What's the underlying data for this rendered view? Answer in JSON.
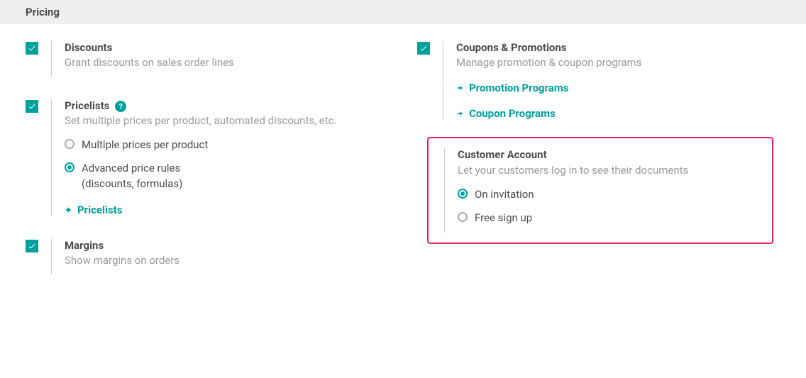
{
  "section_title": "Pricing",
  "left": {
    "discounts": {
      "title": "Discounts",
      "desc": "Grant discounts on sales order lines"
    },
    "pricelists": {
      "title": "Pricelists",
      "desc": "Set multiple prices per product, automated discounts, etc.",
      "option_multiple": "Multiple prices per product",
      "option_advanced": "Advanced price rules\n(discounts, formulas)",
      "link": "Pricelists"
    },
    "margins": {
      "title": "Margins",
      "desc": "Show margins on orders"
    }
  },
  "right": {
    "coupons": {
      "title": "Coupons & Promotions",
      "desc": "Manage promotion & coupon programs",
      "link_promo": "Promotion Programs",
      "link_coupon": "Coupon Programs"
    },
    "customer_account": {
      "title": "Customer Account",
      "desc": "Let your customers log in to see their documents",
      "option_invitation": "On invitation",
      "option_free": "Free sign up"
    }
  }
}
